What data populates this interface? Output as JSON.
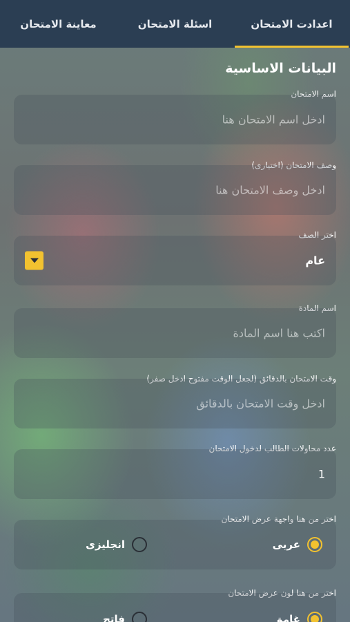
{
  "tabs": [
    {
      "label": "اعدادت الامتحان",
      "active": true
    },
    {
      "label": "اسئلة الامتحان",
      "active": false
    },
    {
      "label": "معاينة الامتحان",
      "active": false
    }
  ],
  "section_title": "البيانات الاساسية",
  "fields": {
    "exam_name": {
      "label": "اسم الامتحان",
      "placeholder": "ادخل اسم الامتحان هنا"
    },
    "exam_description": {
      "label": "وصف الامتحان (اختيارى)",
      "placeholder": "ادخل وصف الامتحان هنا"
    },
    "grade": {
      "label": "اختر الصف",
      "value": "عام"
    },
    "subject": {
      "label": "اسم المادة",
      "placeholder": "اكتب هنا اسم المادة"
    },
    "duration": {
      "label": "وقت الامتحان بالدقائق (لجعل الوقت مفتوح ادخل صفر)",
      "placeholder": "ادخل وقت الامتحان بالدقائق"
    },
    "attempts": {
      "label": "عدد محاولات الطالب لدخول الامتحان",
      "value": "1"
    }
  },
  "interface_language": {
    "label": "اختر من هنا واجهة عرض الامتحان",
    "options": [
      {
        "label": "عربى",
        "checked": true
      },
      {
        "label": "انجليزى",
        "checked": false
      }
    ]
  },
  "display_color": {
    "label": "اختر من هنا لون عرض الامتحان",
    "options": [
      {
        "label": "غامق",
        "checked": true
      },
      {
        "label": "فاتح",
        "checked": false
      }
    ]
  },
  "colors": {
    "accent": "#f2c230",
    "topbar": "#2b3e53"
  },
  "icons": {
    "dropdown": "caret-down-icon",
    "radio_checked": "radio-checked-icon",
    "radio_unchecked": "radio-unchecked-icon"
  }
}
